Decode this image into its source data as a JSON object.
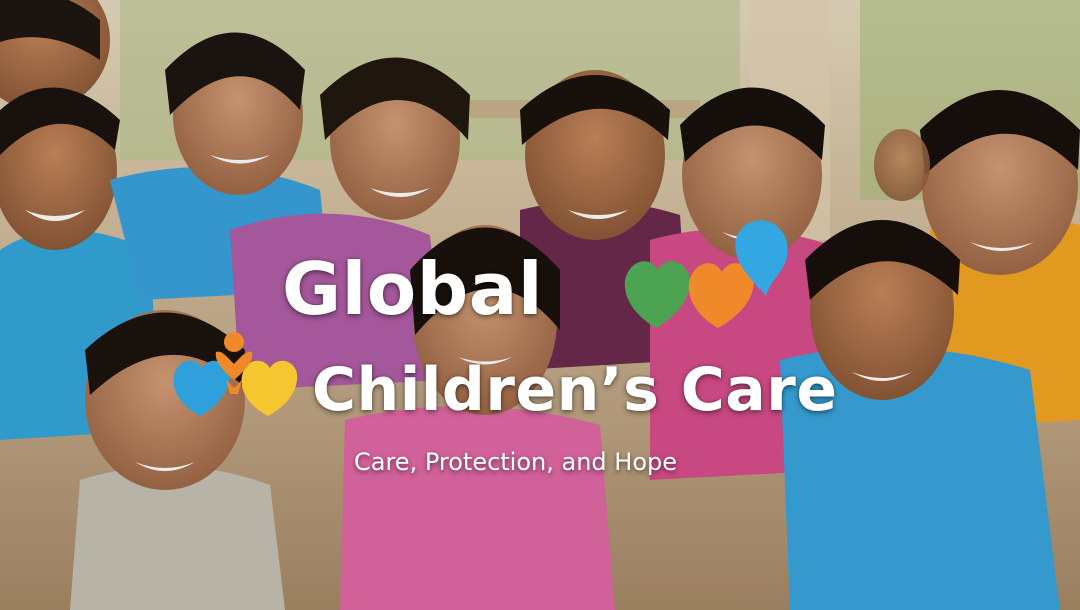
{
  "brand": {
    "title_line_1": "Global",
    "title_line_2": "Children’s Care",
    "tagline": "Care, Protection, and Hope"
  },
  "colors": {
    "title_text": "#ffffff",
    "logo_green": "#4ca352",
    "logo_orange": "#f0892a",
    "logo_blue": "#2fa0dc",
    "logo_yellow": "#f5c630",
    "logo_sky": "#33a7e2"
  },
  "icons": {
    "emblem_left": "family-heart-emblem-icon",
    "emblem_right": "hearts-globe-emblem-icon"
  }
}
